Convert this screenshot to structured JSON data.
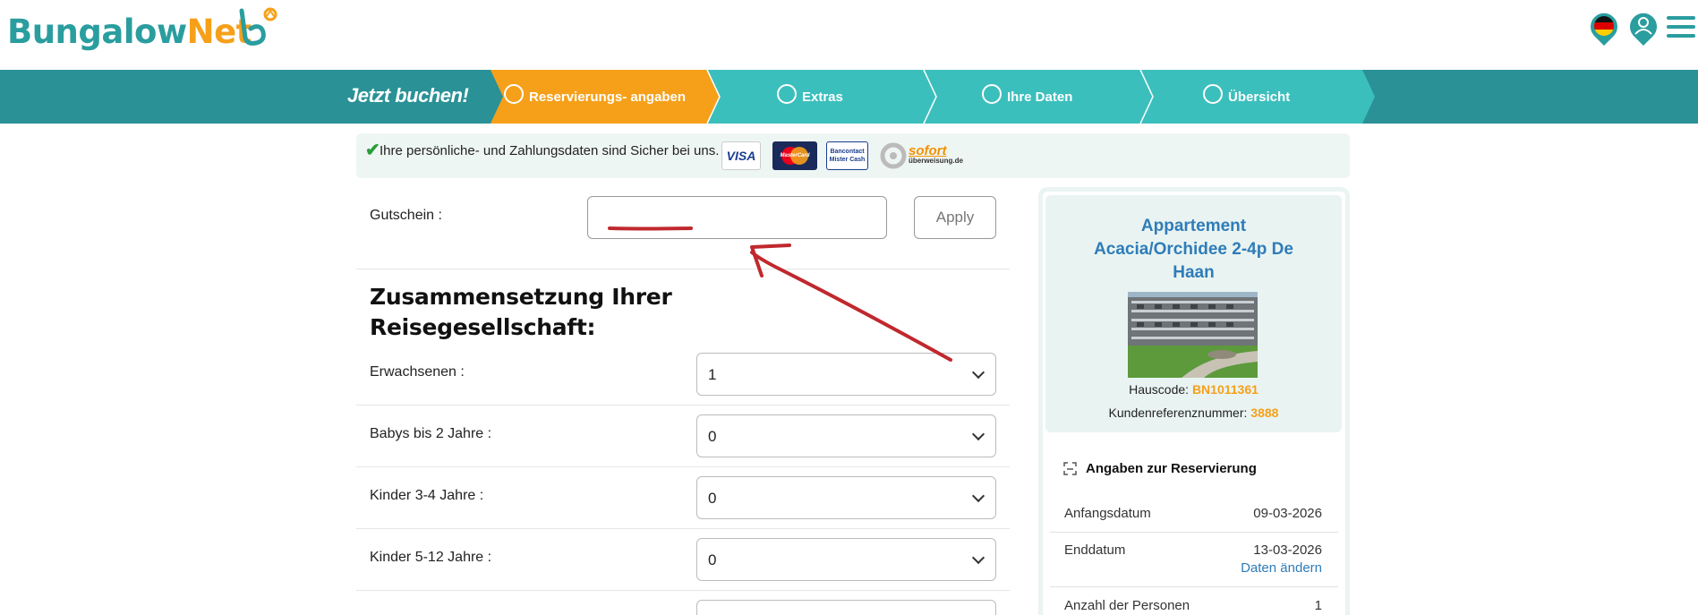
{
  "header": {
    "logo": {
      "part1": "Bungalow",
      "part2": "Net"
    },
    "icons": [
      "logo-mark-icon",
      "german-flag-icon",
      "user-account-icon",
      "hamburger-menu-icon"
    ]
  },
  "steps": {
    "title": "Jetzt buchen!",
    "items": [
      {
        "label": "Reservierungs- angaben",
        "active": true
      },
      {
        "label": "Extras",
        "active": false
      },
      {
        "label": "Ihre Daten",
        "active": false
      },
      {
        "label": "Übersicht",
        "active": false
      }
    ]
  },
  "secure": {
    "text": "Ihre persönliche- und Zahlungsdaten sind Sicher bei uns.",
    "logos": {
      "visa": "VISA",
      "mastercard": "MasterCard",
      "bancontact_1": "Bancontact",
      "bancontact_2": "Mister Cash",
      "sofort_1": "sofort",
      "sofort_2": "überweisung.de"
    }
  },
  "voucher": {
    "label": "Gutschein :",
    "value": "",
    "apply_label": "Apply"
  },
  "party": {
    "heading": "Zusammensetzung Ihrer Reisegesellschaft:",
    "fields": [
      {
        "label": "Erwachsenen :",
        "value": "1"
      },
      {
        "label": "Babys bis 2 Jahre :",
        "value": "0"
      },
      {
        "label": "Kinder 3-4 Jahre :",
        "value": "0"
      },
      {
        "label": "Kinder 5-12 Jahre :",
        "value": "0"
      }
    ]
  },
  "sidebar": {
    "property_title": "Appartement Acacia/Orchidee 2-4p De Haan",
    "hauscode_label": "Hauscode:",
    "hauscode": "BN1011361",
    "kunden_label": "Kundenreferenznummer:",
    "kunden": "3888",
    "reservation_heading": "Angaben zur Reservierung",
    "rows": [
      {
        "label": "Anfangsdatum",
        "value": "09-03-2026"
      },
      {
        "label": "Enddatum",
        "value": "13-03-2026",
        "link": "Daten ändern"
      },
      {
        "label": "Anzahl der Personen",
        "value": "1"
      }
    ]
  },
  "colors": {
    "teal": "#2a9d9f",
    "orange": "#f6a01a",
    "step_teal": "#3bbfbd",
    "bar_dark": "#2a9196",
    "link_blue": "#2f7cb8",
    "annotation_red": "#c0282d"
  }
}
